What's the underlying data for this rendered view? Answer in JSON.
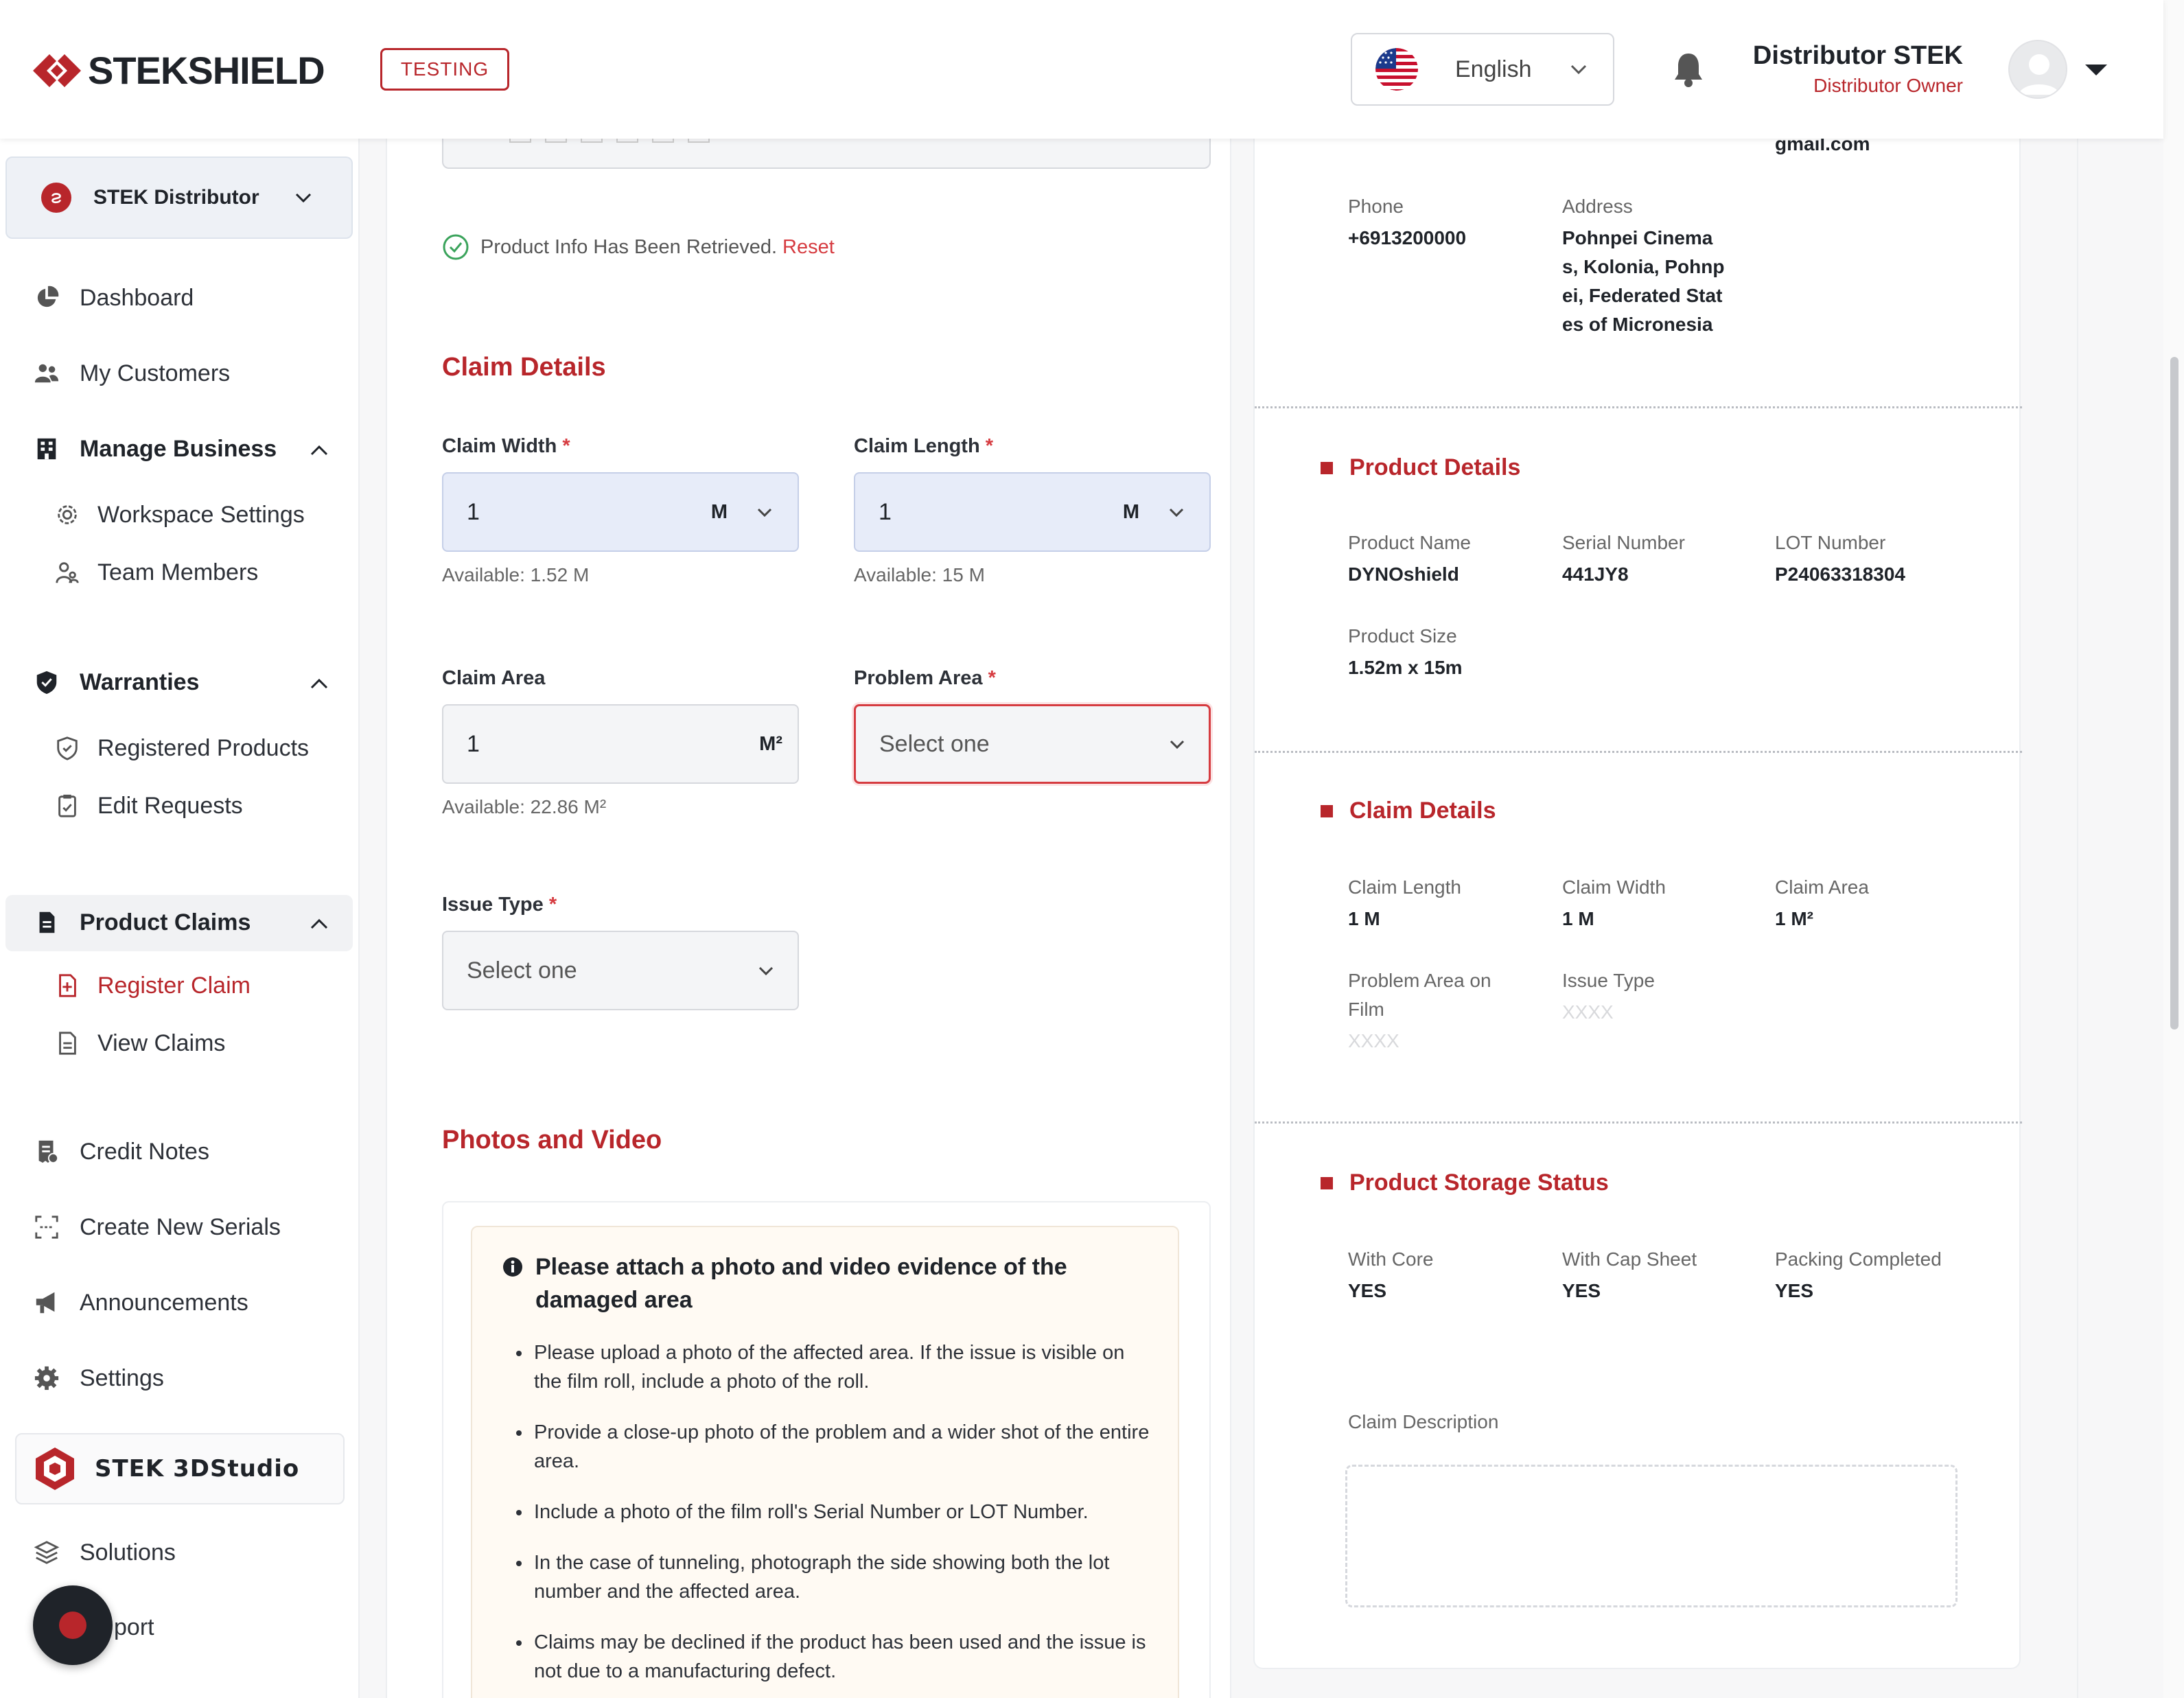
{
  "header": {
    "brand": "STEKSHIELD",
    "env_badge": "TESTING",
    "language": "English",
    "user_name": "Distributor STEK",
    "user_role": "Distributor Owner"
  },
  "sidebar": {
    "org": "STEK Distributor",
    "items": {
      "dashboard": "Dashboard",
      "customers": "My Customers",
      "manage_business": "Manage Business",
      "workspace_settings": "Workspace Settings",
      "team_members": "Team Members",
      "warranties": "Warranties",
      "registered_products": "Registered Products",
      "edit_requests": "Edit Requests",
      "product_claims": "Product Claims",
      "register_claim": "Register Claim",
      "view_claims": "View Claims",
      "credit_notes": "Credit Notes",
      "create_serials": "Create New Serials",
      "announcements": "Announcements",
      "settings": "Settings",
      "studio": "STEK 3DStudio",
      "solutions": "Solutions",
      "support": "port"
    }
  },
  "form": {
    "retrieved_text": "Product Info Has Been Retrieved.",
    "reset_label": "Reset",
    "claim_details_title": "Claim Details",
    "claim_width_label": "Claim Width",
    "claim_width_value": "1",
    "claim_width_unit": "M",
    "claim_width_available": "Available: 1.52 M",
    "claim_length_label": "Claim Length",
    "claim_length_value": "1",
    "claim_length_unit": "M",
    "claim_length_available": "Available: 15 M",
    "claim_area_label": "Claim Area",
    "claim_area_value": "1",
    "claim_area_unit": "M²",
    "claim_area_available": "Available: 22.86 M²",
    "problem_area_label": "Problem Area",
    "problem_area_placeholder": "Select one",
    "issue_type_label": "Issue Type",
    "issue_type_placeholder": "Select one",
    "required_mark": "*",
    "photos_title": "Photos and Video",
    "info_title": "Please attach a photo and video evidence of the damaged area",
    "info_items": [
      "Please upload a photo of the affected area. If the issue is visible on the film roll, include a photo of the roll.",
      "Provide a close-up photo of the problem and a wider shot of the entire area.",
      "Include a photo of the film roll's Serial Number or LOT Number.",
      "In the case of tunneling, photograph the side showing both the lot number and the affected area.",
      "Claims may be declined if the product has been used and the issue is not due to a manufacturing defect."
    ]
  },
  "summary": {
    "email_tail": "gmail.com",
    "phone_label": "Phone",
    "phone_value": "+6913200000",
    "address_label": "Address",
    "address_value": "Pohnpei Cinemas, Kolonia, Pohnpei, Federated States of Micronesia",
    "address_lines": [
      "Pohnpei Cinema",
      "s, Kolonia, Pohnp",
      "ei, Federated Stat",
      "es of Micronesia"
    ],
    "product_details_title": "Product Details",
    "product_name_label": "Product Name",
    "product_name_value": "DYNOshield",
    "serial_label": "Serial Number",
    "serial_value": "441JY8",
    "lot_label": "LOT Number",
    "lot_value": "P24063318304",
    "size_label": "Product Size",
    "size_value": "1.52m x 15m",
    "claim_details_title": "Claim Details",
    "claim_length_label": "Claim Length",
    "claim_length_value": "1 M",
    "claim_width_label": "Claim Width",
    "claim_width_value": "1 M",
    "claim_area_label": "Claim Area",
    "claim_area_value": "1 M²",
    "problem_area_label_line1": "Problem Area on",
    "problem_area_label_line2": "Film",
    "problem_area_value": "XXXX",
    "issue_type_label": "Issue Type",
    "issue_type_value": "XXXX",
    "storage_title": "Product Storage Status",
    "with_core_label": "With Core",
    "with_core_value": "YES",
    "cap_sheet_label": "With Cap Sheet",
    "cap_sheet_value": "YES",
    "packing_label": "Packing Completed",
    "packing_value": "YES",
    "description_label": "Claim Description"
  },
  "colors": {
    "brand": "#b8262b",
    "error": "#d63b40",
    "field_blue": "#e7ecf9"
  }
}
